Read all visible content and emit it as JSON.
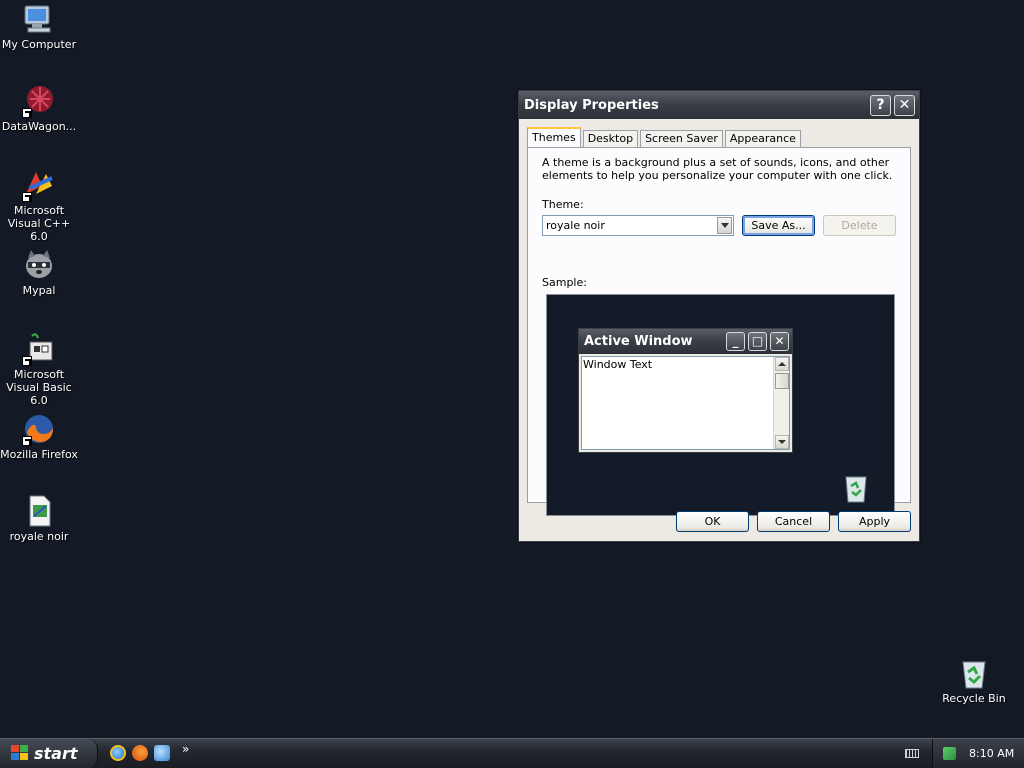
{
  "desktop": {
    "icons": [
      {
        "label": "My Computer"
      },
      {
        "label": "DataWagon..."
      },
      {
        "label": "Microsoft Visual C++ 6.0"
      },
      {
        "label": "Mypal"
      },
      {
        "label": "Microsoft Visual Basic 6.0"
      },
      {
        "label": "Mozilla Firefox"
      },
      {
        "label": "royale noir"
      }
    ],
    "recycle_bin": {
      "label": "Recycle Bin"
    }
  },
  "dialog": {
    "title": "Display Properties",
    "help_glyph": "?",
    "close_glyph": "✕",
    "tabs": [
      {
        "label": "Themes",
        "active": true
      },
      {
        "label": "Desktop"
      },
      {
        "label": "Screen Saver"
      },
      {
        "label": "Appearance"
      }
    ],
    "description": "A theme is a background plus a set of sounds, icons, and other elements to help you personalize your computer with one click.",
    "theme_label": "Theme:",
    "theme_value": "royale noir",
    "save_as_label": "Save As...",
    "delete_label": "Delete",
    "sample_label": "Sample:",
    "sample_window": {
      "title": "Active Window",
      "body_text": "Window Text",
      "min_glyph": "_",
      "max_glyph": "□",
      "close_glyph": "✕"
    },
    "ok_label": "OK",
    "cancel_label": "Cancel",
    "apply_label": "Apply"
  },
  "taskbar": {
    "start_label": "start",
    "chevron": "»",
    "clock": "8:10 AM"
  },
  "colors": {
    "desktop_bg": "#131a26",
    "titlebar": "#3b3f47",
    "tab_highlight": "#ffc83c"
  }
}
